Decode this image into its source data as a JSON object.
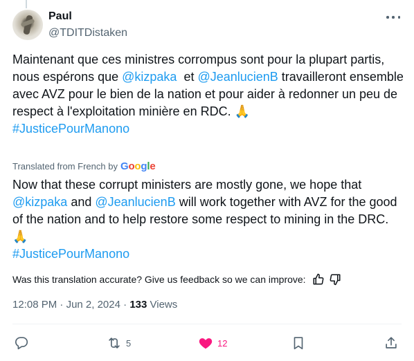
{
  "author": {
    "display_name": "Paul",
    "handle": "@TDITDistaken"
  },
  "tweet": {
    "original": {
      "part1": "Maintenant que ces ministres corrompus sont pour la plupart partis, nous espérons que ",
      "mention1": "@kizpaka",
      "part2": "  et ",
      "mention2": "@JeanlucienB",
      "part3": " travailleront ensemble avec AVZ pour le bien de la nation et pour aider à redonner un peu de respect à l'exploitation minière en RDC. ",
      "emoji": "🙏",
      "hashtag": "#JusticePourManono"
    },
    "translation_notice": {
      "text": "Translated from French by",
      "provider": [
        "G",
        "o",
        "o",
        "g",
        "l",
        "e"
      ]
    },
    "translated": {
      "part1": "Now that these corrupt ministers are mostly gone, we hope that ",
      "mention1": "@kizpaka",
      "part2": " and ",
      "mention2": "@JeanlucienB",
      "part3": " will work together with AVZ for the good of the nation and to help restore some respect to mining in the DRC. ",
      "emoji": "🙏",
      "hashtag": "#JusticePourManono"
    }
  },
  "feedback": {
    "question": "Was this translation accurate? Give us feedback so we can improve:"
  },
  "meta": {
    "time": "12:08 PM",
    "separator": " · ",
    "date": "Jun 2, 2024",
    "separator2": " · ",
    "views_count": "133",
    "views_label": " Views"
  },
  "actions": {
    "reply_count": "",
    "repost_count": "5",
    "like_count": "12",
    "liked": true
  },
  "colors": {
    "link": "#1d9bf0",
    "like": "#f91880",
    "muted": "#536471",
    "text": "#0f1419"
  }
}
